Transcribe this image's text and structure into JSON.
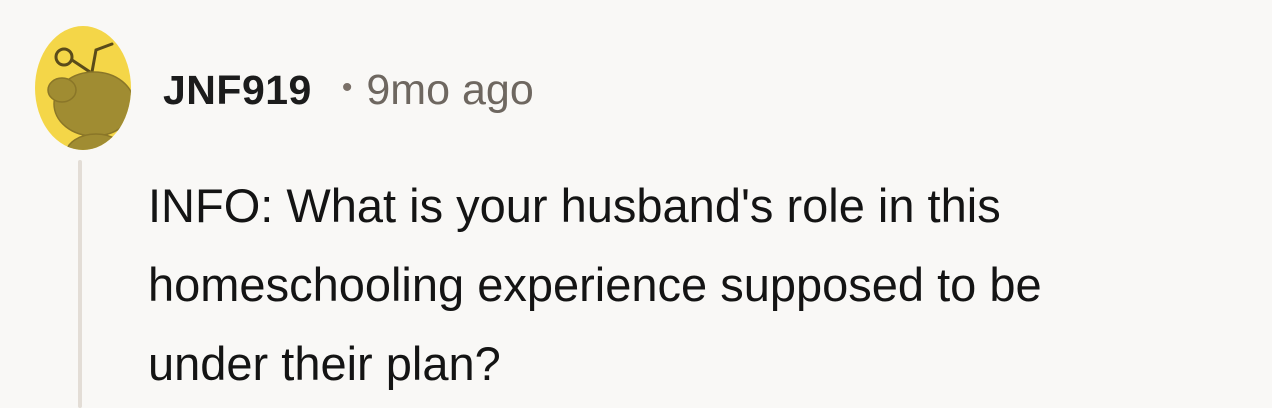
{
  "comment": {
    "author": "JNF919",
    "separator": "•",
    "timestamp": "9mo ago",
    "body_lines": [
      "INFO: What is your husband's role in this",
      "homeschooling experience supposed to be",
      "under their plan?"
    ]
  },
  "avatar": {
    "icon": "reddit-snoo-avatar",
    "background_color": "#f4d648",
    "figure_color": "#a08c32"
  },
  "colors": {
    "page_background": "#f9f8f6",
    "thread_line": "#e3ddd6",
    "text_primary": "#141414",
    "text_secondary": "#6e6760"
  }
}
